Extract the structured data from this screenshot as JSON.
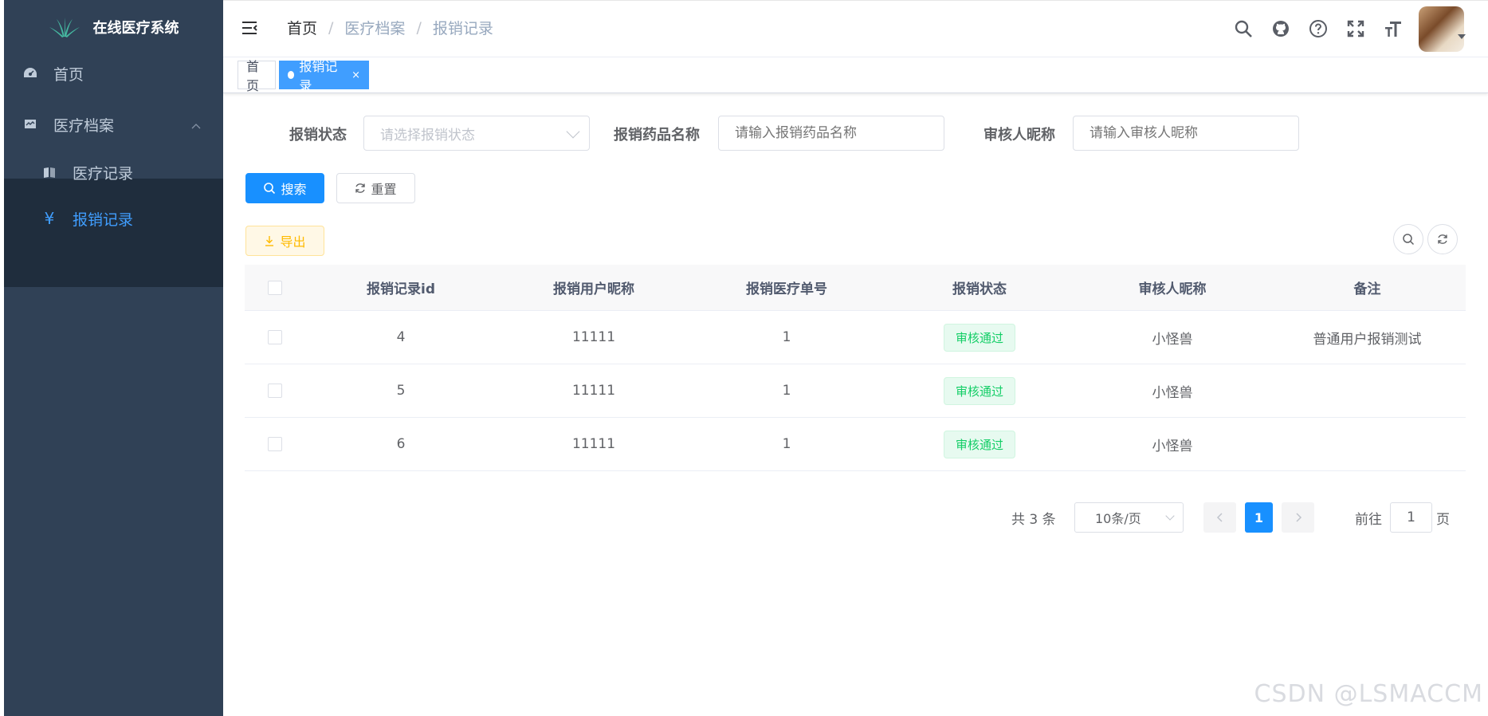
{
  "app": {
    "title": "在线医疗系统"
  },
  "sidebar": {
    "items": [
      {
        "label": "首页",
        "icon": "dashboard-icon"
      },
      {
        "label": "医疗档案",
        "icon": "monitor-icon",
        "expanded": true,
        "children": [
          {
            "label": "医疗记录",
            "icon": "book-icon"
          },
          {
            "label": "报销记录",
            "icon": "yen-icon",
            "active": true
          }
        ]
      }
    ]
  },
  "navbar": {
    "breadcrumb": [
      "首页",
      "医疗档案",
      "报销记录"
    ],
    "separator": "/"
  },
  "tags": [
    {
      "label": "首页",
      "active": false
    },
    {
      "label": "报销记录",
      "active": true,
      "close": "×"
    }
  ],
  "search": {
    "status_label": "报销状态",
    "status_placeholder": "请选择报销状态",
    "drug_label": "报销药品名称",
    "drug_placeholder": "请输入报销药品名称",
    "reviewer_label": "审核人昵称",
    "reviewer_placeholder": "请输入审核人昵称",
    "search_button": "搜索",
    "reset_button": "重置"
  },
  "toolbar": {
    "export_button": "导出"
  },
  "table": {
    "headers": [
      "报销记录id",
      "报销用户昵称",
      "报销医疗单号",
      "报销状态",
      "审核人昵称",
      "备注"
    ],
    "rows": [
      {
        "id": "4",
        "user": "11111",
        "order": "1",
        "status": "审核通过",
        "reviewer": "小怪兽",
        "remark": "普通用户报销测试"
      },
      {
        "id": "5",
        "user": "11111",
        "order": "1",
        "status": "审核通过",
        "reviewer": "小怪兽",
        "remark": ""
      },
      {
        "id": "6",
        "user": "11111",
        "order": "1",
        "status": "审核通过",
        "reviewer": "小怪兽",
        "remark": ""
      }
    ]
  },
  "pagination": {
    "total_text": "共 3 条",
    "page_size": "10条/页",
    "current_page": "1",
    "goto_label": "前往",
    "goto_value": "1",
    "goto_suffix": "页"
  },
  "watermark": "CSDN @LSMACCM",
  "colors": {
    "sidebar_bg": "#304156",
    "primary": "#1890ff",
    "success": "#13ce66",
    "warning": "#ffba00"
  }
}
